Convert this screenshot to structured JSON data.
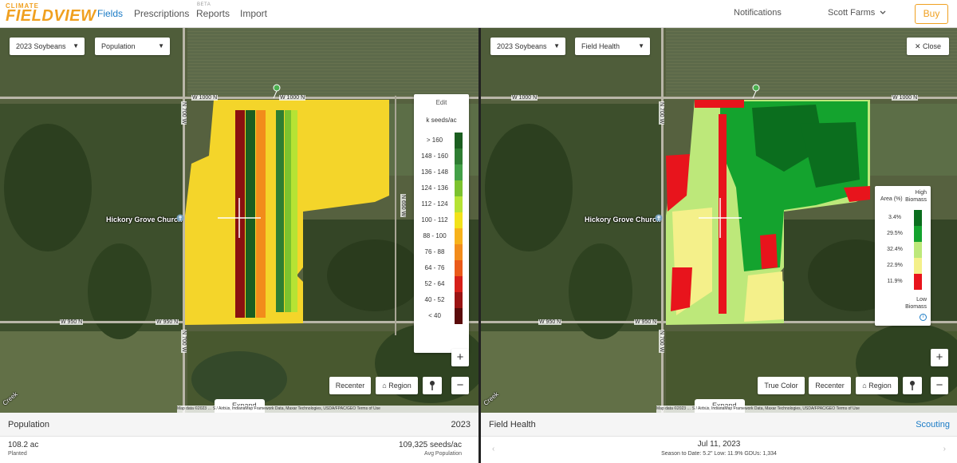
{
  "nav": {
    "logo_top": "CLIMATE",
    "logo_main": "FIELDVIEW",
    "links": [
      "Fields",
      "Prescriptions",
      "Reports",
      "Import"
    ],
    "reports_badge": "BETA",
    "notifications": "Notifications",
    "account": "Scott Farms",
    "buy": "Buy"
  },
  "left_map": {
    "season_select": "2023 Soybeans",
    "layer_select": "Population",
    "legend": {
      "edit": "Edit",
      "units": "k seeds/ac",
      "items": [
        {
          "label": "> 160",
          "color": "#1b5e20"
        },
        {
          "label": "148 - 160",
          "color": "#2e7d32"
        },
        {
          "label": "136 - 148",
          "color": "#43a047"
        },
        {
          "label": "124 - 136",
          "color": "#7cc22e"
        },
        {
          "label": "112 - 124",
          "color": "#b6e334"
        },
        {
          "label": "100 - 112",
          "color": "#f2e21b"
        },
        {
          "label": "88 - 100",
          "color": "#f7b21b"
        },
        {
          "label": "76 - 88",
          "color": "#f28c1b"
        },
        {
          "label": "64 - 76",
          "color": "#ea5a1a"
        },
        {
          "label": "52 - 64",
          "color": "#d6201a"
        },
        {
          "label": "40 - 52",
          "color": "#9a1414"
        },
        {
          "label": "< 40",
          "color": "#5a0b0b"
        }
      ]
    },
    "place": "Hickory Grove Church",
    "roads": [
      "W 1000 N",
      "W 1000 N",
      "N 700 W",
      "N 650 W",
      "W 950 N",
      "W 950 N",
      "N 700 W"
    ],
    "creek": "Creek",
    "buttons": {
      "recenter": "Recenter",
      "region": "Region",
      "zoom_in": "+",
      "zoom_out": "−"
    },
    "expand": "Expand",
    "attribution": "Map data ©2023 … S / Airbus, IndianaMap Framework Data, Maxar Technologies, USDA/FPAC/GEO   Terms of Use"
  },
  "right_map": {
    "season_select": "2023 Soybeans",
    "layer_select": "Field Health",
    "close": "Close",
    "legend": {
      "area_label": "Area (%)",
      "high": "High Biomass",
      "low": "Low Biomass",
      "items": [
        {
          "pct": "3.4%",
          "color": "#0b6e1e"
        },
        {
          "pct": "29.5%",
          "color": "#14a32e"
        },
        {
          "pct": "32.4%",
          "color": "#bde87a"
        },
        {
          "pct": "22.9%",
          "color": "#f4f08a"
        },
        {
          "pct": "11.9%",
          "color": "#e8141c"
        }
      ]
    },
    "place": "Hickory Grove Church",
    "roads": [
      "W 1000 N",
      "W 1000 N",
      "N 700 W",
      "W 950 N",
      "W 950 N",
      "N 700 W"
    ],
    "creek": "Creek",
    "buttons": {
      "true_color": "True Color",
      "recenter": "Recenter",
      "region": "Region",
      "zoom_in": "+",
      "zoom_out": "−"
    },
    "expand": "Expand",
    "attribution": "Map data ©2023 … S / Airbus, IndianaMap Framework Data, Maxar Technologies, USDA/FPAC/GEO   Terms of Use"
  },
  "left_bottom": {
    "title": "Population",
    "year": "2023",
    "acres": "108.2 ac",
    "acres_label": "Planted",
    "avg_pop": "109,325 seeds/ac",
    "avg_pop_label": "Avg Population"
  },
  "right_bottom": {
    "title": "Field Health",
    "scouting": "Scouting",
    "date": "Jul 11, 2023",
    "season_info": "Season to Date: 5.2\" Low: 11.9% GDUs: 1,334",
    "prev": "‹",
    "next": "›"
  }
}
